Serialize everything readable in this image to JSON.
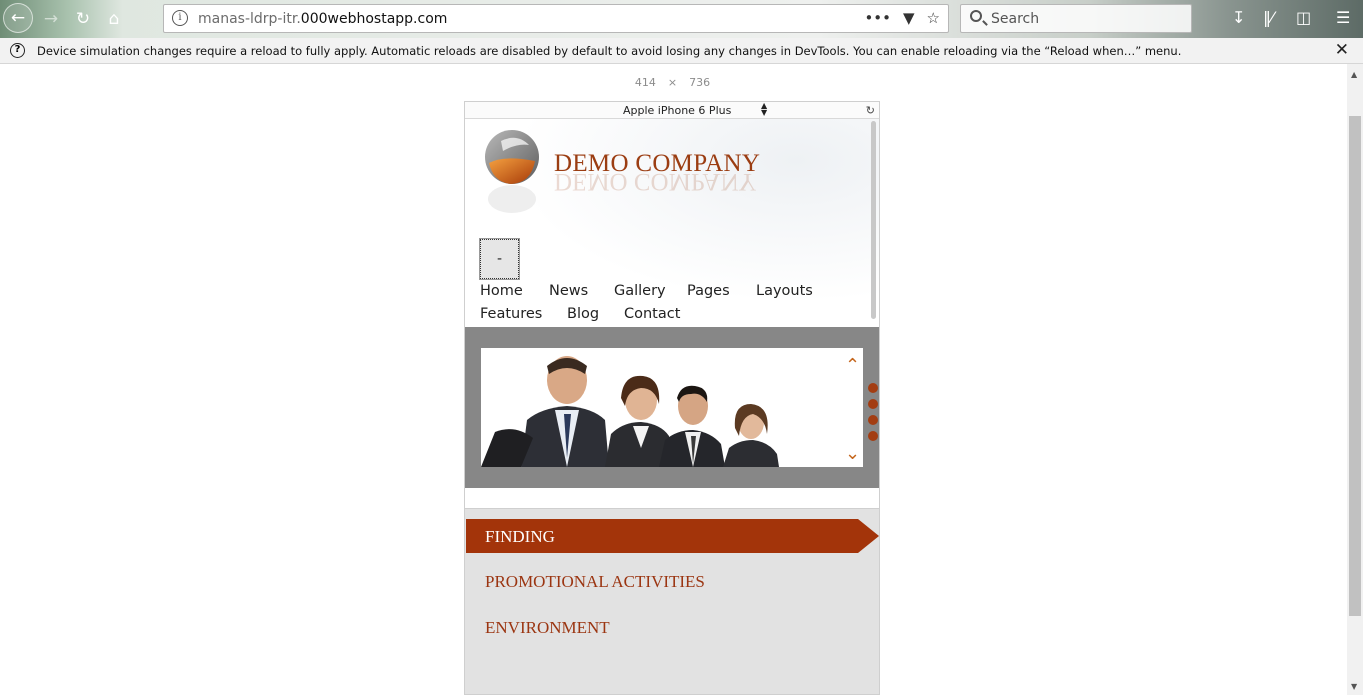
{
  "browser": {
    "url_grey": "manas-ldrp-itr.",
    "url_main": "000webhostapp.com",
    "search_placeholder": "Search",
    "icons": [
      "back-icon",
      "forward-icon",
      "reload-icon",
      "home-icon",
      "info-icon",
      "more-icon",
      "pocket-icon",
      "star-icon",
      "search-icon",
      "download-icon",
      "library-icon",
      "sidebar-icon",
      "menu-icon"
    ]
  },
  "notification": {
    "text": "Device simulation changes require a reload to fully apply. Automatic reloads are disabled by default to avoid losing any changes in DevTools. You can enable reloading via the “Reload when…” menu.",
    "icon": "help-icon",
    "close": "✕"
  },
  "devtools": {
    "width": "414",
    "times": "×",
    "height": "736",
    "device_name": "Apple iPhone 6 Plus"
  },
  "site": {
    "company": "DEMO COMPANY",
    "menu_toggle": "-",
    "nav_row1": [
      "Home",
      "News",
      "Gallery",
      "Pages",
      "Layouts"
    ],
    "nav_row2": [
      "Features",
      "Blog",
      "Contact"
    ],
    "tabs": {
      "active": "FINDING",
      "second": "PROMOTIONAL ACTIVITIES",
      "third": "ENVIRONMENT"
    },
    "accent_color": "#a3340a"
  }
}
